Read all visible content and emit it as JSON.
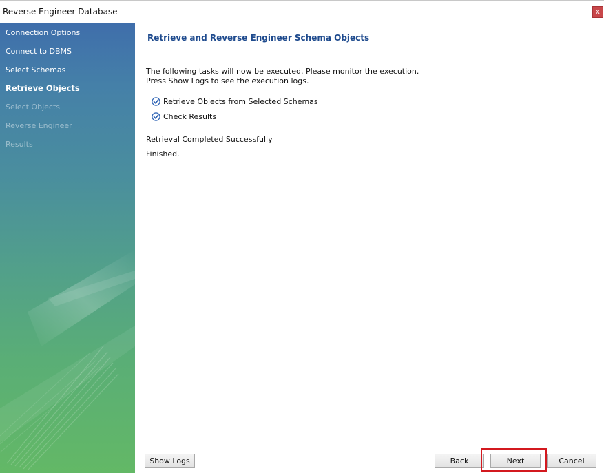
{
  "window": {
    "title": "Reverse Engineer Database",
    "close_label": "x"
  },
  "sidebar": {
    "items": [
      {
        "label": "Connection Options",
        "state": "done"
      },
      {
        "label": "Connect to DBMS",
        "state": "done"
      },
      {
        "label": "Select Schemas",
        "state": "done"
      },
      {
        "label": "Retrieve Objects",
        "state": "active"
      },
      {
        "label": "Select Objects",
        "state": "pending"
      },
      {
        "label": "Reverse Engineer",
        "state": "pending"
      },
      {
        "label": "Results",
        "state": "pending"
      }
    ]
  },
  "main": {
    "heading": "Retrieve and Reverse Engineer Schema Objects",
    "description_line1": "The following tasks will now be executed. Please monitor the execution.",
    "description_line2": "Press Show Logs to see the execution logs.",
    "tasks": [
      {
        "label": "Retrieve Objects from Selected Schemas",
        "checked": true
      },
      {
        "label": "Check Results",
        "checked": true
      }
    ],
    "status_line1": "Retrieval Completed Successfully",
    "status_line2": "Finished."
  },
  "footer": {
    "show_logs_label": "Show Logs",
    "back_label": "Back",
    "next_label": "Next",
    "cancel_label": "Cancel"
  },
  "colors": {
    "heading": "#1f4b8e",
    "checkmark": "#2c62b4",
    "highlight": "#d3191f",
    "close_button": "#c8474a"
  }
}
